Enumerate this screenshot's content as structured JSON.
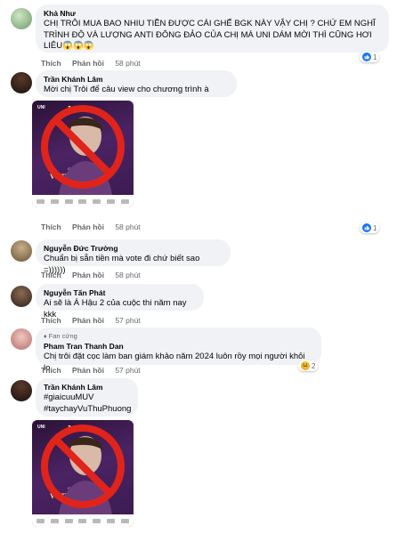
{
  "comments": [
    {
      "author": "Khả Như",
      "text": "CHỊ TRÔI MUA BAO NHIU TIỀN ĐƯỢC CÁI GHẾ BGK NÀY VẬY CHỊ ? CHỨ EM NGHĨ TRÌNH ĐỘ VÀ LƯỢNG ANTI ĐÔNG ĐẢO CỦA CHỊ MÀ UNI DÁM MỜI THÌ CŨNG HƠI LIÊU😱😱😱",
      "like_label": "Thích",
      "reply_label": "Phản hồi",
      "time": "58 phút",
      "reaction_count": "1"
    },
    {
      "author": "Trần Khánh Lâm",
      "text": "Mời chị Trôi để câu view cho chương trình à",
      "like_label": "Thích",
      "reply_label": "Phản hồi",
      "time": "58 phút",
      "reaction_count": "1",
      "poster": {
        "brand": "UNI",
        "title": "M.U",
        "subtitle": "Vũ Thu Phương",
        "caption": "GIÁM KHẢO"
      }
    },
    {
      "author": "Nguyễn Đức Trường",
      "text": "Chuẩn bị sẵn tiền mà vote đi chứ biết sao =))))))",
      "like_label": "Thích",
      "reply_label": "Phản hồi",
      "time": "58 phút"
    },
    {
      "author": "Nguyễn Tấn Phát",
      "text": "Ai sẽ là Á Hậu 2 của cuộc thi năm nay kkk",
      "like_label": "Thích",
      "reply_label": "Phản hồi",
      "time": "57 phút"
    },
    {
      "badge": "Fan cứng",
      "author": "Pham Tran Thanh Dan",
      "text": "Chị trôi đặt cọc làm ban giám khảo năm 2024 luôn rồy mọi người khỏi lo",
      "like_label": "Thích",
      "reply_label": "Phản hồi",
      "time": "57 phút",
      "reaction_count": "2"
    },
    {
      "author": "Trần Khánh Lâm",
      "hashtags": [
        "#giaicuuMUV",
        "#taychayVuThuPhuong"
      ],
      "poster": {
        "brand": "UNI",
        "title": "M.U",
        "subtitle": "Vũ Thu Phương",
        "caption": "GIÁM KHẢO"
      }
    }
  ],
  "colors": {
    "bubble": "#f0f2f5",
    "secondary_text": "#65676b",
    "like_blue": "#1877f2",
    "ban_red": "#e0241b",
    "poster_purple": "#4b2363"
  }
}
